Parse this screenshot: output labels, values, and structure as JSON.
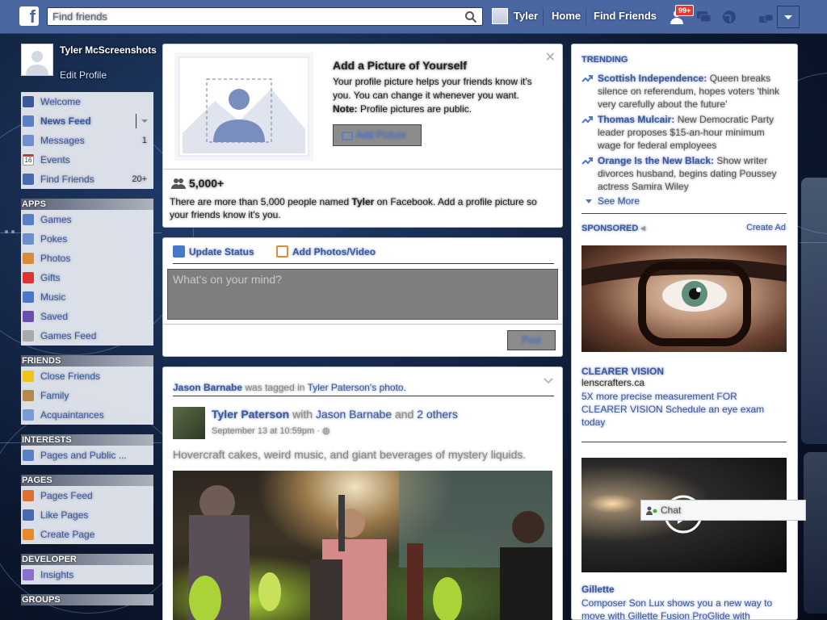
{
  "search": {
    "placeholder": "Find friends"
  },
  "topnav": {
    "user": "Tyler",
    "home": "Home",
    "find_friends": "Find Friends",
    "notif_count": "99+"
  },
  "profile": {
    "name": "Tyler McScreenshots",
    "edit": "Edit Profile"
  },
  "left_nav": {
    "main": [
      {
        "label": "Welcome",
        "icon": "facebook-icon",
        "count": ""
      },
      {
        "label": "News Feed",
        "icon": "news-feed-icon",
        "count": ""
      },
      {
        "label": "Messages",
        "icon": "messages-icon",
        "count": "1"
      },
      {
        "label": "Events",
        "icon": "calendar-icon",
        "count": "",
        "icon_text": "16"
      },
      {
        "label": "Find Friends",
        "icon": "friends-icon",
        "count": "20+"
      }
    ],
    "apps_header": "APPS",
    "apps": [
      {
        "label": "Games",
        "icon": "games-icon"
      },
      {
        "label": "Pokes",
        "icon": "pokes-icon"
      },
      {
        "label": "Photos",
        "icon": "photos-icon"
      },
      {
        "label": "Gifts",
        "icon": "gift-icon"
      },
      {
        "label": "Music",
        "icon": "music-icon"
      },
      {
        "label": "Saved",
        "icon": "saved-icon"
      },
      {
        "label": "Games Feed",
        "icon": "controller-icon"
      }
    ],
    "friends_header": "FRIENDS",
    "friends": [
      {
        "label": "Close Friends",
        "icon": "star-icon"
      },
      {
        "label": "Family",
        "icon": "house-icon"
      },
      {
        "label": "Acquaintances",
        "icon": "acquaintances-icon"
      }
    ],
    "interests_header": "INTERESTS",
    "interests": [
      {
        "label": "Pages and Public ...",
        "icon": "rss-icon"
      }
    ],
    "pages_header": "PAGES",
    "pages": [
      {
        "label": "Pages Feed",
        "icon": "megaphone-icon"
      },
      {
        "label": "Like Pages",
        "icon": "thumbs-up-icon"
      },
      {
        "label": "Create Page",
        "icon": "plus-icon"
      }
    ],
    "developer_header": "DEVELOPER",
    "developer": [
      {
        "label": "Insights",
        "icon": "insights-icon"
      }
    ],
    "groups_header": "GROUPS"
  },
  "add_picture": {
    "title": "Add a Picture of Yourself",
    "text": "Your profile picture helps your friends know it's you. You can change it whenever you want.",
    "note_label": "Note:",
    "note": "Profile pictures are public.",
    "button": "Add Picture",
    "count": "5,000+",
    "names_pre": "There are more than 5,000 people named",
    "names_bold": "Tyler",
    "names_post": "on Facebook. Add a profile picture so your friends know it's you."
  },
  "composer": {
    "update_status": "Update Status",
    "add_photos": "Add Photos/Video",
    "placeholder": "What's on your mind?",
    "post": "Post"
  },
  "story": {
    "actor": "Jason Barnabe",
    "action": "was tagged in",
    "object": "Tyler Paterson's photo.",
    "author": "Tyler Paterson",
    "with": "with",
    "tagged": "Jason Barnabe",
    "and": "and",
    "others": "2 others",
    "timestamp": "September 13 at 10:59pm",
    "caption": "Hovercraft cakes, weird music, and giant beverages of mystery liquids."
  },
  "trending": {
    "header": "TRENDING",
    "items": [
      {
        "name": "Scottish Independence:",
        "desc": "Queen breaks silence on referendum, hopes voters 'think very carefully about the future'"
      },
      {
        "name": "Thomas Mulcair:",
        "desc": "New Democratic Party leader proposes $15-an-hour minimum wage for federal employees"
      },
      {
        "name": "Orange Is the New Black:",
        "desc": "Show writer divorces husband, begins dating Poussey actress Samira Wiley"
      }
    ],
    "see_more": "See More"
  },
  "sponsored": {
    "header": "SPONSORED",
    "create_ad": "Create Ad",
    "ad1_title": "CLEARER VISION",
    "ad1_domain": "lenscrafters.ca",
    "ad1_text": "5X more precise measurement FOR CLEARER VISION Schedule an eye exam today",
    "ad2_title": "Gillette",
    "ad2_text": "Composer Son Lux shows you a new way to move with Gillette Fusion ProGlide with"
  },
  "chat": {
    "label": "Chat"
  }
}
